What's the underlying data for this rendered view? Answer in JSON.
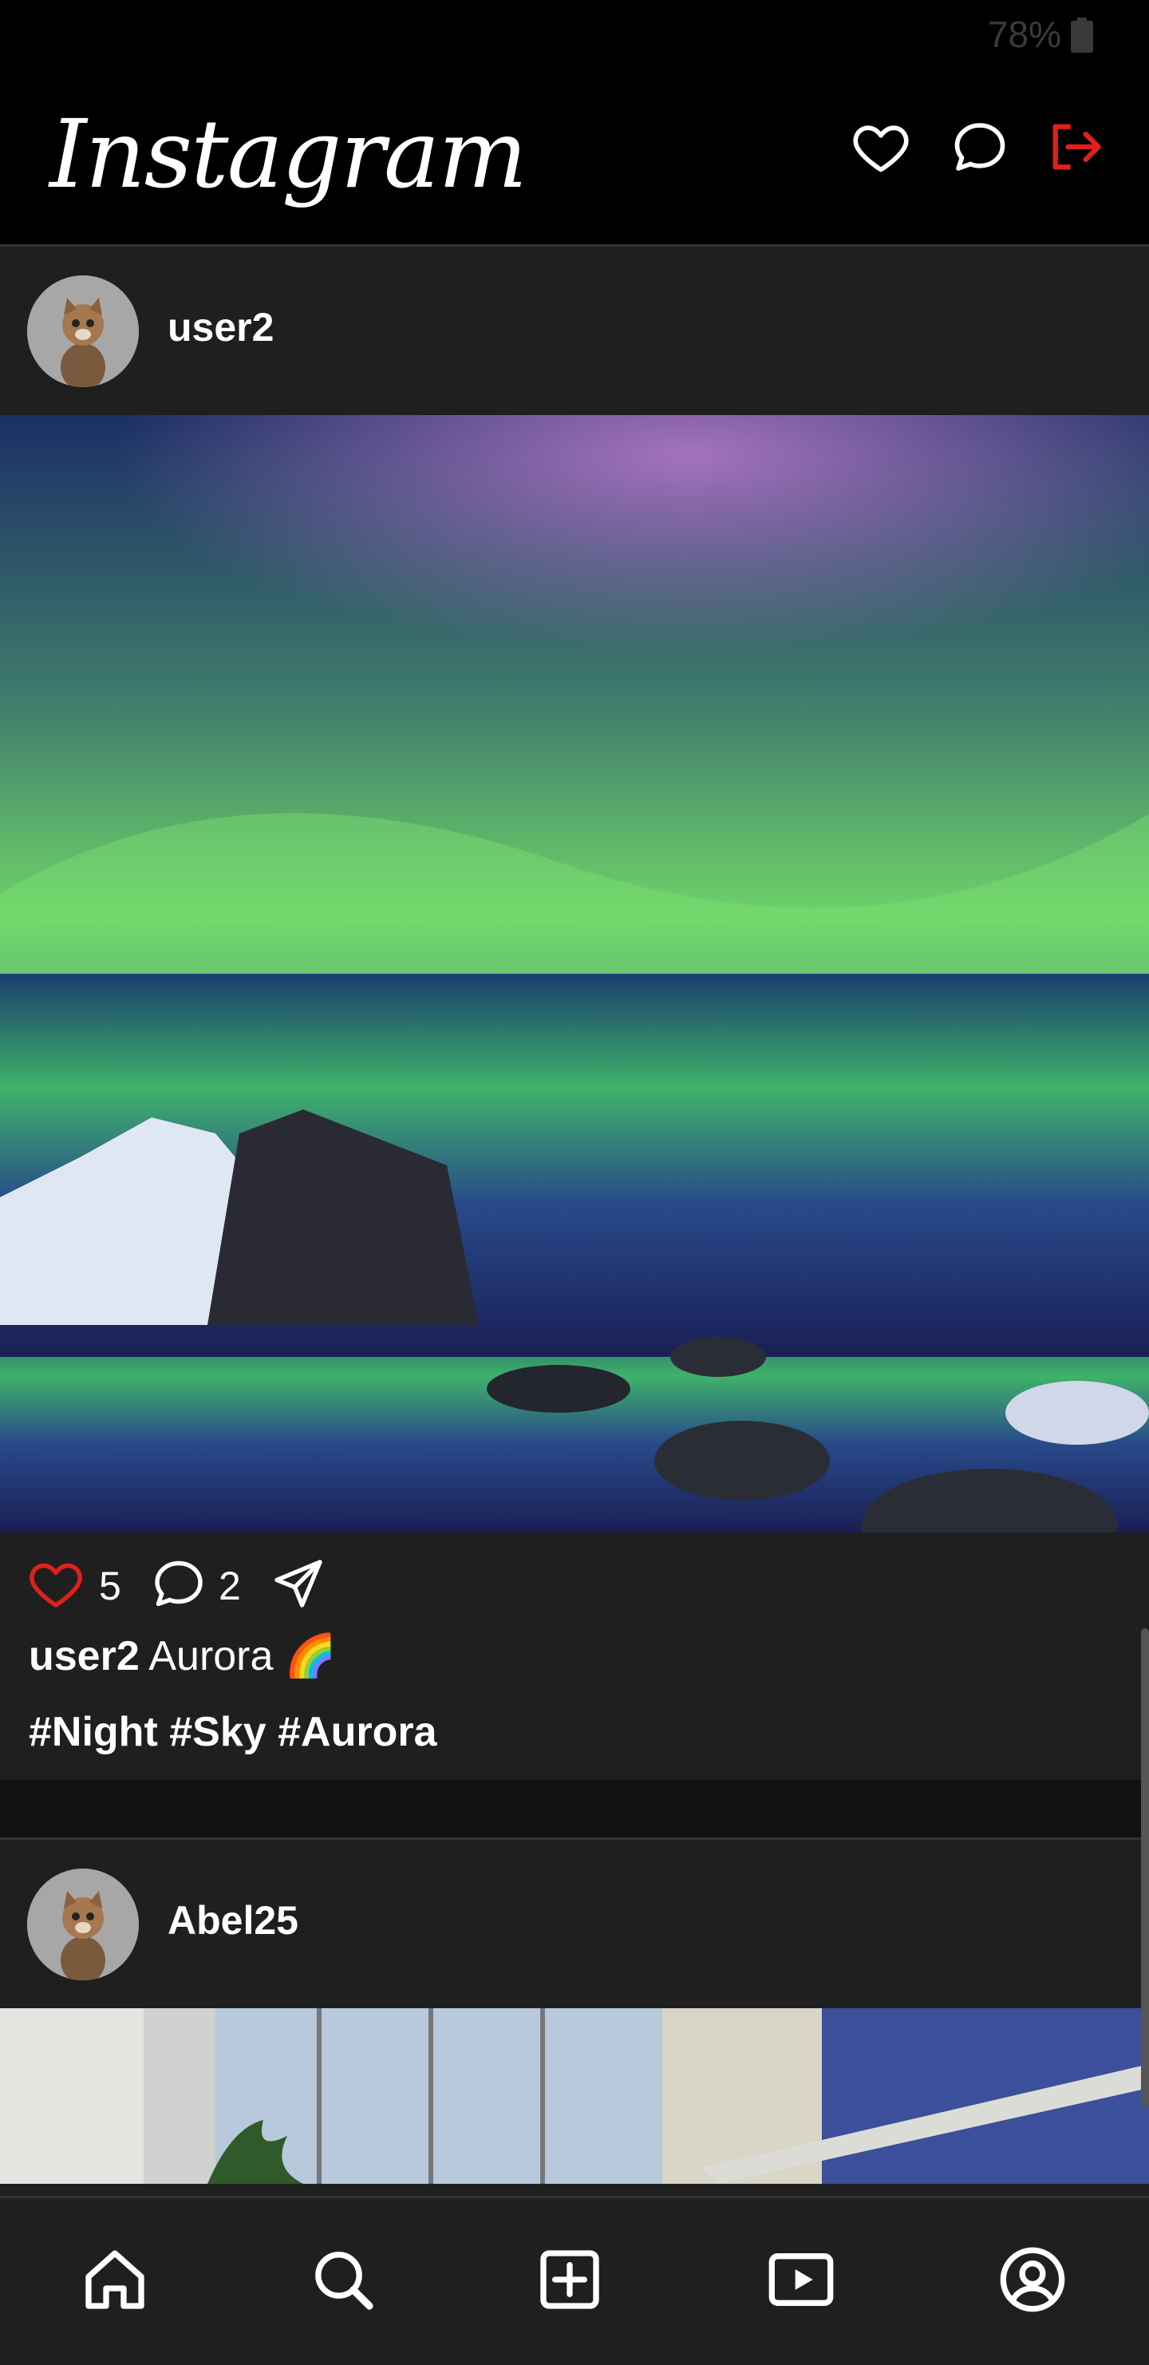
{
  "status_bar": {
    "battery": "78%"
  },
  "header": {
    "logo": "Instagram",
    "icons": [
      "heart-icon",
      "chat-icon",
      "logout-icon"
    ],
    "logout_color": "#e0201b"
  },
  "posts": [
    {
      "username": "user2",
      "image": "aurora-landscape",
      "likes": "5",
      "comments": "2",
      "caption_user": "user2",
      "caption_text": "Aurora 🌈",
      "hashtags": "#Night #Sky #Aurora"
    },
    {
      "username": "Abel25",
      "image": "glass-building"
    }
  ],
  "like_color": "#e0201b",
  "bottom_nav": [
    "home-icon",
    "search-icon",
    "add-post-icon",
    "reels-icon",
    "profile-icon"
  ]
}
